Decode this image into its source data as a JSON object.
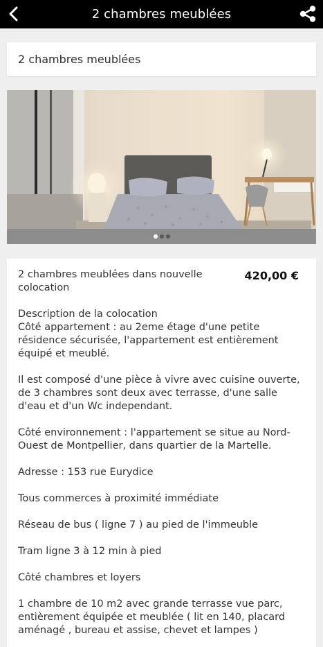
{
  "header": {
    "title": "2 chambres meublées",
    "back_icon": "chevron-left-icon",
    "share_icon": "share-icon",
    "background": "#000000"
  },
  "title_card": {
    "text": "2 chambres meublées"
  },
  "gallery": {
    "image_alt": "Chambre avec lit double, lampes de chevet et bureau",
    "pages": 3,
    "active_page": 1
  },
  "listing": {
    "summary": "2 chambres meublées dans nouvelle colocation",
    "price": "420,00 €",
    "paragraphs": [
      "Description de la colocation\nCôté appartement : au 2eme étage d'une petite résidence sécurisée, l'appartement est entièrement équipé et meublé.",
      "Il est composé d'une pièce à vivre avec cuisine ouverte, de 3 chambres sont deux avec terrasse, d'une salle d'eau et d'un Wc independant.",
      "Côté environnement : l'appartement se situe au Nord-Ouest de Montpellier, dans quartier de la Martelle.",
      "Adresse : 153 rue Eurydice",
      "Tous commerces à proximité immédiate",
      "Réseau de bus ( ligne 7 ) au pied de l'immeuble",
      "Tram ligne 3 à 12 min à pied",
      "Côté chambres et loyers",
      "1 chambre de 10 m2 avec grande terrasse vue parc, entièrement équipée et meublée ( lit en 140, placard aménagé , bureau et assise, chevet et lampes )"
    ]
  }
}
